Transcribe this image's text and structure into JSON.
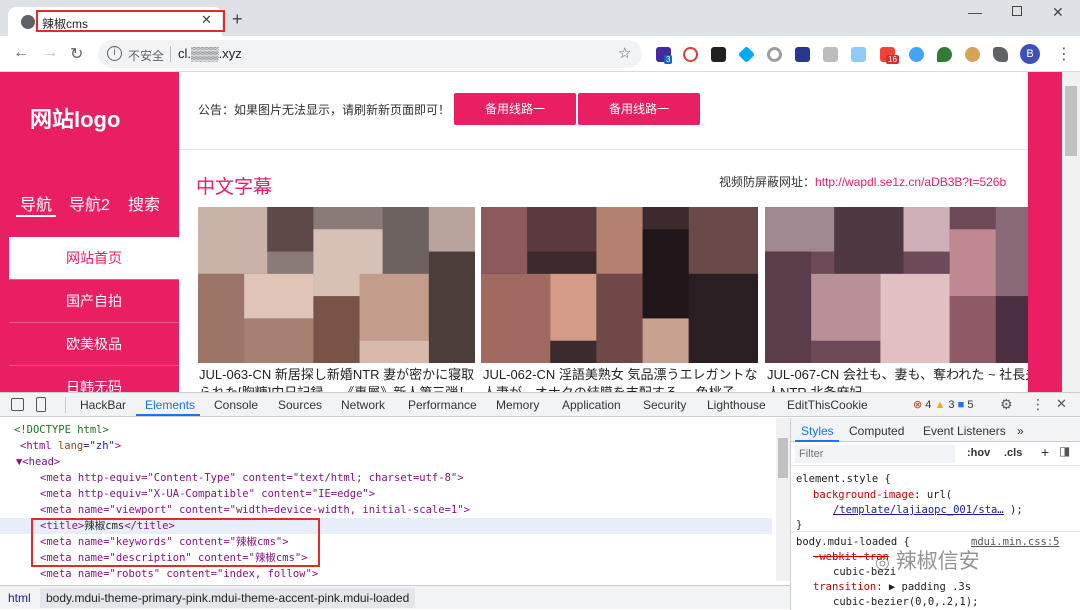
{
  "browser": {
    "tab_title": "辣椒cms",
    "security": "不安全",
    "url": "cl.▒▒▒.xyz",
    "profile": "B",
    "ext_badges": {
      "first": "3",
      "second": "16"
    }
  },
  "site": {
    "logo": "网站logo",
    "nav_tabs": [
      "导航",
      "导航2",
      "搜索"
    ],
    "nav_items": [
      "网站首页",
      "国产自拍",
      "欧美极品",
      "日韩无码"
    ],
    "notice": "公告：如果图片无法显示，请刷新新页面即可！",
    "buttons": [
      "备用线路一",
      "备用线路一"
    ],
    "section_title": "中文字幕",
    "anti_block_label": "视频防屏蔽网址：",
    "anti_block_url": "http://wapdl.se1z.cn/aDB3B?t=526b",
    "videos": [
      {
        "line1": "JUL-063-CN 新居探し新婚NTR 妻が密かに寝取",
        "line2": "られた[胸糖]中日記録 ... 《專屬》新人第三弾！"
      },
      {
        "line1": "JUL-062-CN 淫語美熟女 気品漂うエレガントな",
        "line2": "人妻が、オナクの結膜を支配する ... 色桃子"
      },
      {
        "line1": "JUL-067-CN 会社も、妻も、奪われた ~ 社長夫",
        "line2": "人NTR 北条麻妃"
      }
    ]
  },
  "devtools": {
    "tabs": [
      "HackBar",
      "Elements",
      "Console",
      "Sources",
      "Network",
      "Performance",
      "Memory",
      "Application",
      "Security",
      "Lighthouse",
      "EditThisCookie"
    ],
    "errors": "4",
    "warnings": "3",
    "messages": "5",
    "dom_lines": {
      "l0": "<!DOCTYPE html>",
      "l1a": "<html ",
      "l1b": "lang",
      "l1c": "=\"zh\"",
      "l1d": ">",
      "l2": "▼<head>",
      "l3": "<meta http-equiv=\"Content-Type\" content=\"text/html; charset=utf-8\">",
      "l4": "<meta http-equiv=\"X-UA-Compatible\" content=\"IE=edge\">",
      "l5": "<meta name=\"viewport\" content=\"width=device-width, initial-scale=1\">",
      "l6a": "<title>",
      "l6b": "辣椒cms",
      "l6c": "</title>",
      "l7": "<meta name=\"keywords\" content=\"辣椒cms\">",
      "l8": "<meta name=\"description\" content=\"辣椒cms\">",
      "l9": "<meta name=\"robots\" content=\"index, follow\">"
    },
    "styles_tabs": [
      "Styles",
      "Computed",
      "Event Listeners",
      "»"
    ],
    "filter_placeholder": "Filter",
    "hov": ":hov",
    "cls": ".cls",
    "styles": {
      "el_style": "element.style {",
      "bg_prop": "background-image",
      "bg_val_pre": "url(",
      "bg_link": "/template/lajiaopc_001/sta…",
      "bg_val_post": ");",
      "close": "}",
      "rule_selector": "body.mdui-loaded {",
      "rule_source": "mdui.min.css:5",
      "webkit": "-webkit-tran",
      "cubic1": "cubic-bezi",
      "transition_prop": "transition:",
      "transition_val": "▶ padding .3s",
      "cubic2": "cubic-bezier(0,0,.2,1);"
    },
    "breadcrumb": [
      "html",
      "body.mdui-theme-primary-pink.mdui-theme-accent-pink.mdui-loaded"
    ]
  },
  "watermark": "辣椒信安",
  "colors": {
    "accent": "#e91e63",
    "highlight": "#e02b2b",
    "devtools_active": "#1a73e8"
  }
}
